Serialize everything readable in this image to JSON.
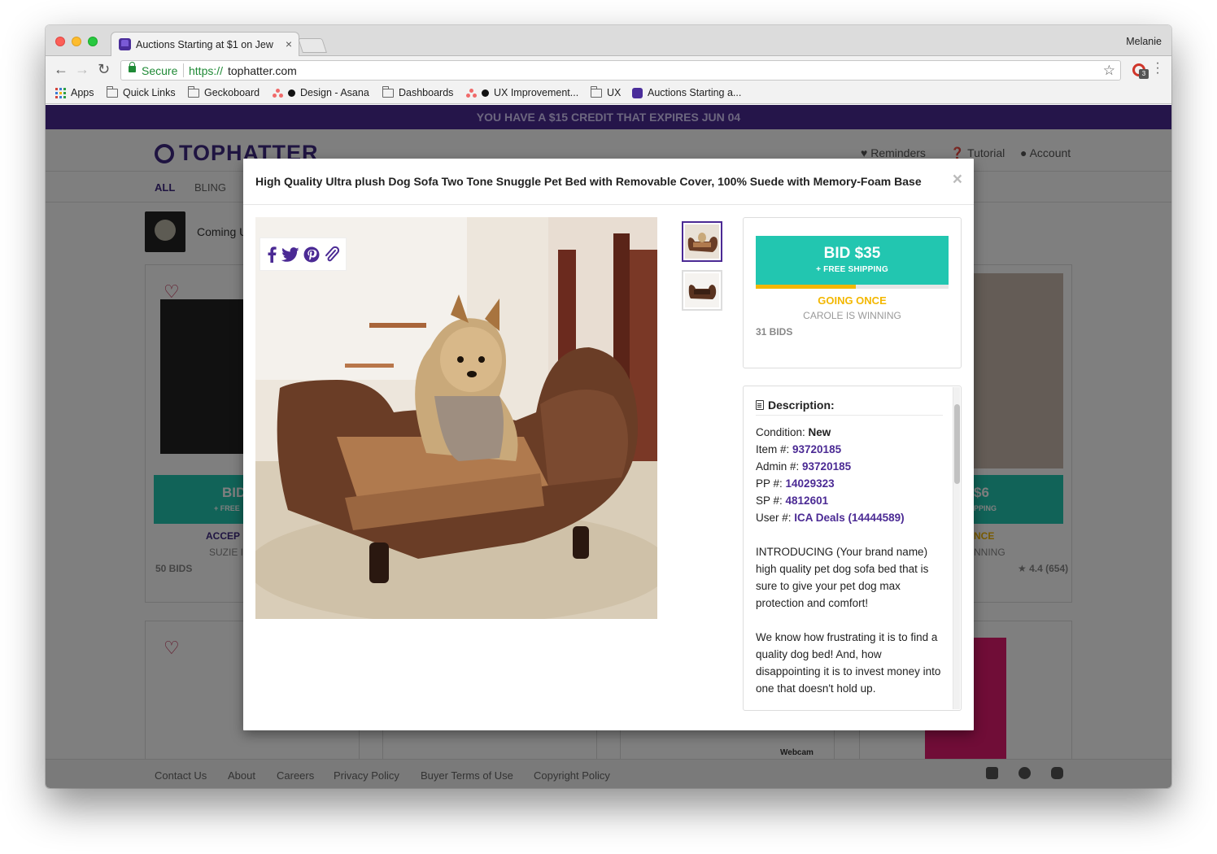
{
  "browser": {
    "tab_title": "Auctions Starting at $1 on Jew",
    "tab_close": "×",
    "profile": "Melanie",
    "secure_label": "Secure",
    "url_scheme": "https://",
    "url_host": "tophatter.com",
    "star": "☆",
    "ext_badge": "3",
    "bookmarks": [
      {
        "label": "Apps",
        "icon": "apps-grid-icon"
      },
      {
        "label": "Quick Links",
        "icon": "folder-icon"
      },
      {
        "label": "Geckoboard",
        "icon": "folder-icon"
      },
      {
        "label": "Design - Asana",
        "icon": "asana-icon"
      },
      {
        "label": "Dashboards",
        "icon": "folder-icon"
      },
      {
        "label": "UX Improvement...",
        "icon": "asana-icon"
      },
      {
        "label": "UX",
        "icon": "folder-icon"
      },
      {
        "label": "Auctions Starting a...",
        "icon": "tophatter-icon"
      }
    ]
  },
  "page": {
    "promo": "YOU HAVE A $15 CREDIT THAT EXPIRES JUN 04",
    "logo": "TOPHATTER",
    "header_nav": [
      "Reminders",
      "Tutorial",
      "Account"
    ],
    "categories": [
      "ALL",
      "BLING"
    ],
    "coming_text": "Coming U",
    "card_left": {
      "bid": "BID",
      "free": "+ FREE",
      "status": "ACCEP",
      "winner": "SUZIE I",
      "bids": "50 BIDS"
    },
    "card_right": {
      "bid": "$6",
      "free": "PPING",
      "status": "NCE",
      "winner": "NNING",
      "rating": "4.4 (654)"
    },
    "footer_links": [
      "Contact Us",
      "About",
      "Careers",
      "Privacy Policy",
      "Buyer Terms of Use",
      "Copyright Policy"
    ],
    "bottom_label": "Webcam"
  },
  "modal": {
    "title": "High Quality Ultra plush Dog Sofa Two Tone Snuggle Pet Bed with Removable Cover, 100% Suede with Memory-Foam Base",
    "close": "×",
    "bid_label": "BID $35",
    "bid_sub": "+ FREE SHIPPING",
    "timer_progress": 0.52,
    "status": "GOING ONCE",
    "winner": "CAROLE IS WINNING",
    "bid_count": "31 BIDS",
    "description": {
      "heading": "Description:",
      "condition_label": "Condition: ",
      "condition": "New",
      "item_label": "Item #: ",
      "item": "93720185",
      "admin_label": "Admin #: ",
      "admin": "93720185",
      "pp_label": "PP #: ",
      "pp": "14029323",
      "sp_label": "SP #: ",
      "sp": "4812601",
      "user_label": "User #: ",
      "user": "ICA Deals (14444589)",
      "para1": "INTRODUCING (Your brand name) high quality pet dog sofa bed that is sure to give your pet dog max protection and comfort!",
      "para2": "We know how frustrating it is to find a quality dog bed! And, how disappointing it is to invest money into one that doesn't hold up."
    }
  },
  "colors": {
    "brand_purple": "#4b2a94",
    "bid_teal": "#22c6b0",
    "going_yellow": "#f3b700"
  }
}
